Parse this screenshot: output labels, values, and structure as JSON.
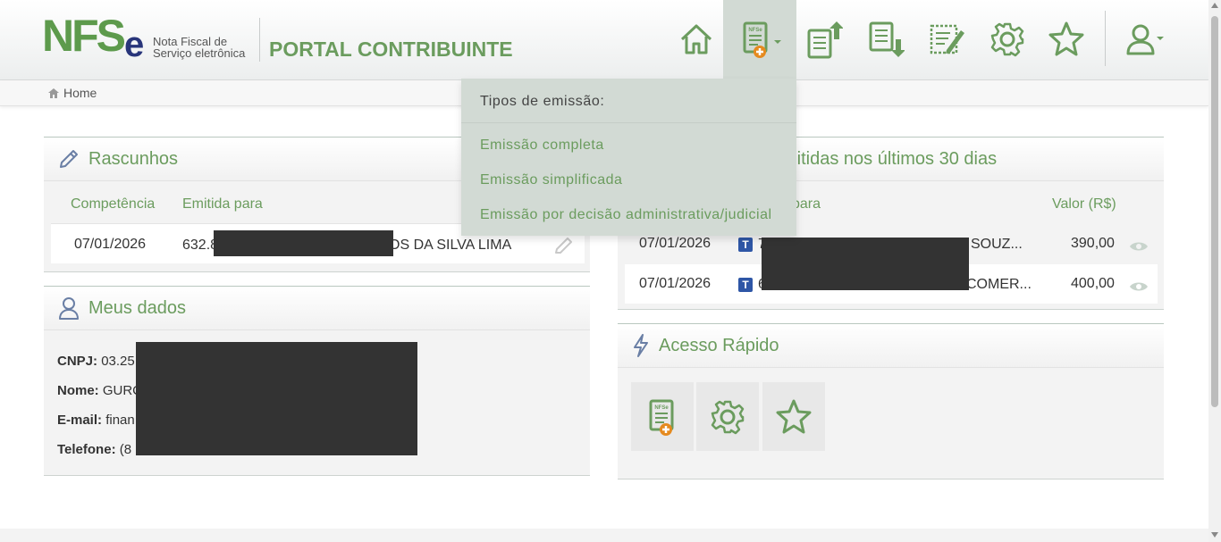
{
  "header": {
    "logo_text": "NFS",
    "logo_e": "e",
    "logo_sub_line1": "Nota Fiscal de",
    "logo_sub_line2": "Serviço eletrônica",
    "portal_title": "PORTAL CONTRIBUINTE",
    "nav_icons": [
      "home-icon",
      "nfse-add-icon",
      "document-upload-icon",
      "document-download-icon",
      "document-edit-icon",
      "gear-icon",
      "star-icon",
      "user-icon"
    ]
  },
  "breadcrumb": {
    "home": "Home"
  },
  "dropdown": {
    "heading": "Tipos de emissão:",
    "items": [
      "Emissão completa",
      "Emissão simplificada",
      "Emissão por decisão administrativa/judicial"
    ]
  },
  "rascunhos": {
    "title": "Rascunhos",
    "col_competencia": "Competência",
    "col_emitida_para": "Emitida para",
    "rows": [
      {
        "competencia": "07/01/2026",
        "emitida_prefix": "632.8",
        "emitida_suffix": "OS DA SILVA LIMA"
      }
    ]
  },
  "emitidas": {
    "title": "mitidas nos últimos 30 dias",
    "col_para": "para",
    "col_valor": "Valor (R$)",
    "rows": [
      {
        "data": "07/01/2026",
        "badge": "T",
        "prefix": "7",
        "suffix": "SOUZ...",
        "valor": "390,00"
      },
      {
        "data": "07/01/2026",
        "badge": "T",
        "prefix": "6",
        "suffix": "COMER...",
        "valor": "400,00"
      }
    ]
  },
  "meus_dados": {
    "title": "Meus dados",
    "fields": [
      {
        "label": "CNPJ:",
        "value": "03.25"
      },
      {
        "label": "Nome:",
        "value": "GURC"
      },
      {
        "label": "E-mail:",
        "value": "finan"
      },
      {
        "label": "Telefone:",
        "value": "(8"
      }
    ]
  },
  "acesso_rapido": {
    "title": "Acesso Rápido",
    "buttons": [
      "nfse-add-icon",
      "gear-icon",
      "star-icon"
    ]
  },
  "colors": {
    "brand_green": "#6b9c5e",
    "brand_blue": "#28357a",
    "accent_orange": "#e58a1f",
    "dropdown_bg": "#d2dad4"
  }
}
